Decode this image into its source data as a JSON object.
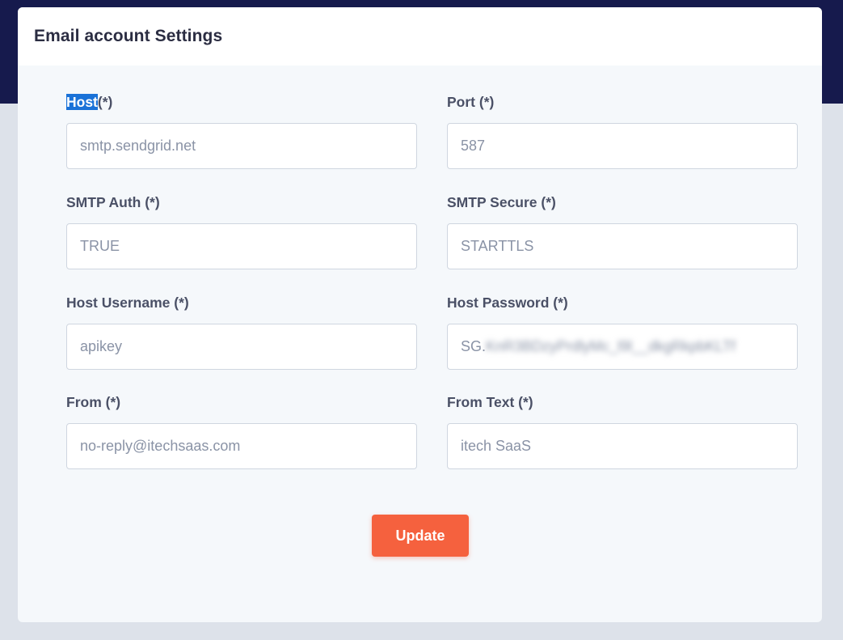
{
  "card": {
    "title": "Email account Settings"
  },
  "fields": {
    "host": {
      "label_word": "Host",
      "label_suffix": "(*)",
      "value": "smtp.sendgrid.net"
    },
    "port": {
      "label": "Port (*)",
      "value": "587"
    },
    "smtp_auth": {
      "label": "SMTP Auth (*)",
      "value": "TRUE"
    },
    "smtp_secure": {
      "label": "SMTP Secure (*)",
      "value": "STARTTLS"
    },
    "host_username": {
      "label": "Host Username (*)",
      "value": "apikey"
    },
    "host_password": {
      "label": "Host Password (*)",
      "value_prefix": "SG.",
      "value_obscured": "KnR3BDzyPrdlyMc_l9l__dkgRkpbKLTf"
    },
    "from": {
      "label": "From (*)",
      "value": "no-reply@itechsaas.com"
    },
    "from_text": {
      "label": "From Text (*)",
      "value": "itech SaaS"
    }
  },
  "actions": {
    "update_label": "Update"
  },
  "colors": {
    "top_band": "#161a4d",
    "page_background": "#dde2ea",
    "accent_button": "#f5613e",
    "text_selection": "#1a72d8"
  }
}
